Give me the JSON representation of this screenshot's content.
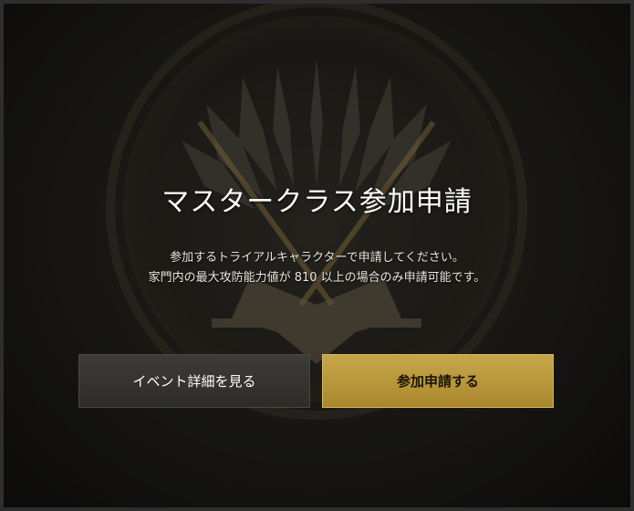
{
  "dialog": {
    "title": "マスタークラス参加申請",
    "description_line1": "参加するトライアルキャラクターで申請してください。",
    "description_line2": "家門内の最大攻防能力値が 810 以上の場合のみ申請可能です。"
  },
  "buttons": {
    "detail_label": "イベント詳細を見る",
    "apply_label": "参加申請する"
  },
  "colors": {
    "accent_gold": "#c7a64a",
    "dark_button": "#3a3935",
    "background": "#1c1b18"
  },
  "icons": {
    "background_emblem": "crossed-swords-crest-icon"
  }
}
